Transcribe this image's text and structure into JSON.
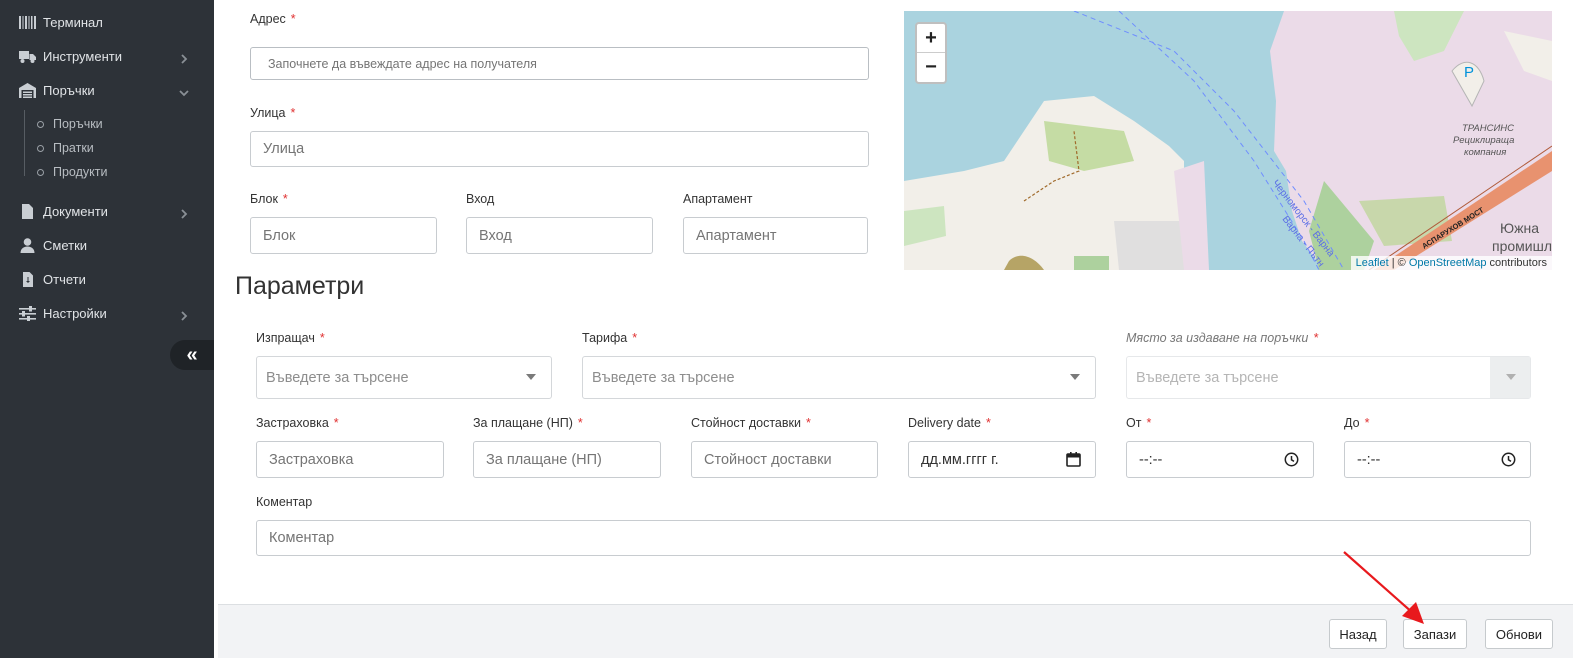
{
  "sidebar": {
    "items": [
      {
        "label": "Терминал",
        "icon": "barcode-icon"
      },
      {
        "label": "Инструменти",
        "icon": "truck-icon"
      },
      {
        "label": "Поръчки",
        "icon": "warehouse-icon"
      },
      {
        "label": "Документи",
        "icon": "document-icon"
      },
      {
        "label": "Сметки",
        "icon": "user-icon"
      },
      {
        "label": "Отчети",
        "icon": "report-icon"
      },
      {
        "label": "Настройки",
        "icon": "sliders-icon"
      }
    ],
    "sub_items": [
      {
        "label": "Поръчки"
      },
      {
        "label": "Пратки"
      },
      {
        "label": "Продукти"
      }
    ],
    "collapse_symbol": "«"
  },
  "address": {
    "label": "Адрес",
    "placeholder": "Започнете да въвеждате адрес на получателя"
  },
  "street": {
    "label": "Улица",
    "placeholder": "Улица"
  },
  "block": {
    "label": "Блок",
    "placeholder": "Блок"
  },
  "entrance": {
    "label": "Вход",
    "placeholder": "Вход"
  },
  "apartment": {
    "label": "Апартамент",
    "placeholder": "Апартамент"
  },
  "map": {
    "zoom_in": "+",
    "zoom_out": "−",
    "attribution_leaflet": "Leaflet",
    "attribution_sep": " | © ",
    "attribution_osm": "OpenStreetMap",
    "attribution_tail": " contributors",
    "labels": {
      "company": "ТРАНСИНС",
      "company_2": "Рециклираща",
      "company_3": "компания",
      "parking": "P",
      "canal": "Черноморск - Варна",
      "canal_2": "Варна - Пътн",
      "bridge": "АСПАРУХОВ МОСТ",
      "district": "Южна",
      "district_2": "промишл"
    }
  },
  "parameters": {
    "heading": "Параметри",
    "sender": {
      "label": "Изпращач",
      "placeholder": "Въведете за търсене"
    },
    "tariff": {
      "label": "Тарифа",
      "placeholder": "Въведете за търсене"
    },
    "issue_place": {
      "label": "Място за издаване на поръчки",
      "placeholder": "Въведете за търсене"
    },
    "insurance": {
      "label": "Застраховка",
      "placeholder": "Застраховка"
    },
    "cod": {
      "label": "За плащане (НП)",
      "placeholder": "За плащане (НП)"
    },
    "delivery_cost": {
      "label": "Стойност доставки",
      "placeholder": "Стойност доставки"
    },
    "delivery_date": {
      "label": "Delivery date",
      "placeholder": "дд.мм.гггг г."
    },
    "from": {
      "label": "От",
      "placeholder": "--:--"
    },
    "to": {
      "label": "До",
      "placeholder": "--:--"
    },
    "comment": {
      "label": "Коментар",
      "placeholder": "Коментар"
    },
    "required_mark": "*"
  },
  "footer": {
    "back": "Назад",
    "save": "Запази",
    "refresh": "Обнови"
  },
  "colors": {
    "sidebar_bg": "#2d3238",
    "required": "#e03030",
    "annotation_arrow": "#e8191d",
    "map_water": "#aad3df"
  }
}
